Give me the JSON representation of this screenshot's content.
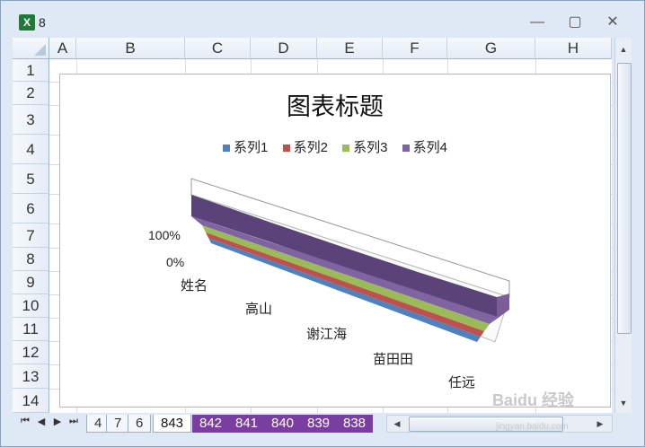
{
  "window": {
    "title": "8"
  },
  "columns": [
    "A",
    "B",
    "C",
    "D",
    "E",
    "F",
    "G",
    "H"
  ],
  "rows": [
    "1",
    "2",
    "3",
    "4",
    "5",
    "6",
    "7",
    "8",
    "9",
    "10",
    "11",
    "12",
    "13",
    "14"
  ],
  "chart_data": {
    "type": "3d-stacked-bar-100",
    "title": "图表标题",
    "legend": [
      "系列1",
      "系列2",
      "系列3",
      "系列4"
    ],
    "legend_placement": "top",
    "categories": [
      "姓名",
      "高山",
      "谢江海",
      "苗田田",
      "任远"
    ],
    "series": [
      {
        "name": "系列1",
        "color": "#4f81bd"
      },
      {
        "name": "系列2",
        "color": "#c0504d"
      },
      {
        "name": "系列3",
        "color": "#9bbb59"
      },
      {
        "name": "系列4",
        "color": "#8064a2"
      }
    ],
    "value_axis_ticks": [
      "0%",
      "100%"
    ]
  },
  "sheet_tabs": {
    "plain": [
      "4",
      "7",
      "6"
    ],
    "active": "843",
    "purple": [
      "842",
      "841",
      "840",
      "839",
      "838"
    ]
  },
  "watermark": {
    "main": "Baidu 经验",
    "sub": "jingyan.baidu.com"
  }
}
